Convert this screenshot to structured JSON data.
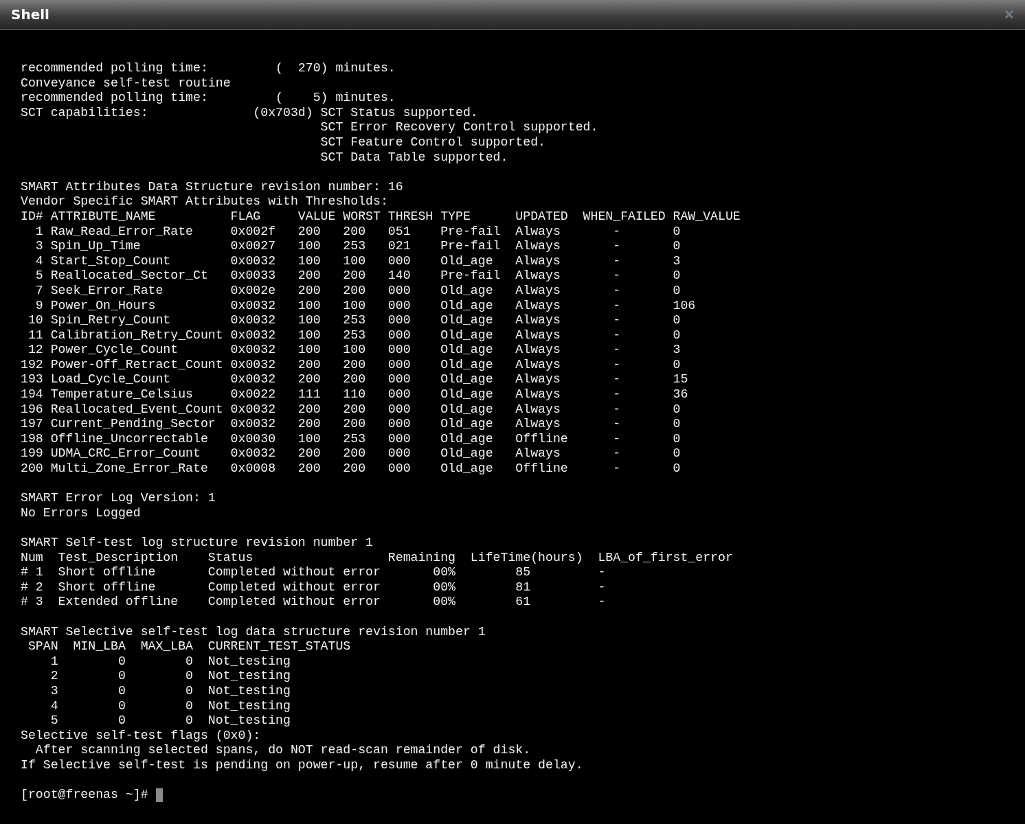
{
  "window": {
    "title": "Shell"
  },
  "terminal": {
    "blocks": [
      [
        "recommended polling time:         (  270) minutes.",
        "Conveyance self-test routine",
        "recommended polling time:         (    5) minutes.",
        "SCT capabilities:              (0x703d) SCT Status supported.",
        "                                        SCT Error Recovery Control supported.",
        "                                        SCT Feature Control supported.",
        "                                        SCT Data Table supported."
      ],
      [
        "SMART Attributes Data Structure revision number: 16",
        "Vendor Specific SMART Attributes with Thresholds:",
        "ID# ATTRIBUTE_NAME          FLAG     VALUE WORST THRESH TYPE      UPDATED  WHEN_FAILED RAW_VALUE",
        "  1 Raw_Read_Error_Rate     0x002f   200   200   051    Pre-fail  Always       -       0",
        "  3 Spin_Up_Time            0x0027   100   253   021    Pre-fail  Always       -       0",
        "  4 Start_Stop_Count        0x0032   100   100   000    Old_age   Always       -       3",
        "  5 Reallocated_Sector_Ct   0x0033   200   200   140    Pre-fail  Always       -       0",
        "  7 Seek_Error_Rate         0x002e   200   200   000    Old_age   Always       -       0",
        "  9 Power_On_Hours          0x0032   100   100   000    Old_age   Always       -       106",
        " 10 Spin_Retry_Count        0x0032   100   253   000    Old_age   Always       -       0",
        " 11 Calibration_Retry_Count 0x0032   100   253   000    Old_age   Always       -       0",
        " 12 Power_Cycle_Count       0x0032   100   100   000    Old_age   Always       -       3",
        "192 Power-Off_Retract_Count 0x0032   200   200   000    Old_age   Always       -       0",
        "193 Load_Cycle_Count        0x0032   200   200   000    Old_age   Always       -       15",
        "194 Temperature_Celsius     0x0022   111   110   000    Old_age   Always       -       36",
        "196 Reallocated_Event_Count 0x0032   200   200   000    Old_age   Always       -       0",
        "197 Current_Pending_Sector  0x0032   200   200   000    Old_age   Always       -       0",
        "198 Offline_Uncorrectable   0x0030   100   253   000    Old_age   Offline      -       0",
        "199 UDMA_CRC_Error_Count    0x0032   200   200   000    Old_age   Always       -       0",
        "200 Multi_Zone_Error_Rate   0x0008   200   200   000    Old_age   Offline      -       0"
      ],
      [
        "SMART Error Log Version: 1",
        "No Errors Logged"
      ],
      [
        "SMART Self-test log structure revision number 1",
        "Num  Test_Description    Status                  Remaining  LifeTime(hours)  LBA_of_first_error",
        "# 1  Short offline       Completed without error       00%        85         -",
        "# 2  Short offline       Completed without error       00%        81         -",
        "# 3  Extended offline    Completed without error       00%        61         -"
      ],
      [
        "SMART Selective self-test log data structure revision number 1",
        " SPAN  MIN_LBA  MAX_LBA  CURRENT_TEST_STATUS",
        "    1        0        0  Not_testing",
        "    2        0        0  Not_testing",
        "    3        0        0  Not_testing",
        "    4        0        0  Not_testing",
        "    5        0        0  Not_testing",
        "Selective self-test flags (0x0):",
        "  After scanning selected spans, do NOT read-scan remainder of disk.",
        "If Selective self-test is pending on power-up, resume after 0 minute delay."
      ]
    ],
    "prompt": "[root@freenas ~]#"
  }
}
